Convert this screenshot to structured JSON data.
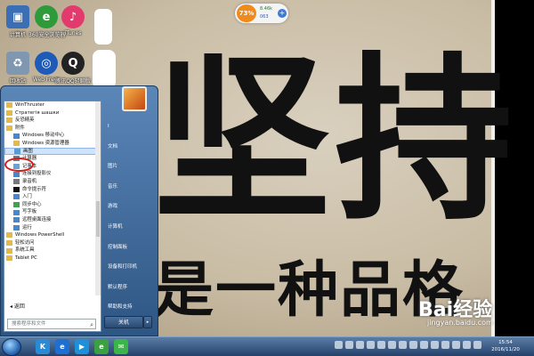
{
  "desktop": {
    "big_text_1": "坚持",
    "big_text_2": "是一种品格",
    "icons": [
      {
        "label": "计算机",
        "color": "#3b6fb5",
        "icon": "computer-icon"
      },
      {
        "label": "360安全浏览器",
        "color": "#2f9a3a",
        "icon": "browser-icon"
      },
      {
        "label": "iTunes",
        "color": "#e23a6c",
        "icon": "music-icon"
      },
      {
        "label": "回收站",
        "color": "#7f97b0",
        "icon": "recycle-bin-icon"
      },
      {
        "label": "Web Freer",
        "color": "#1e5bb8",
        "icon": "globe-icon"
      },
      {
        "label": "腾讯QQ轻聊版",
        "color": "#222222",
        "icon": "qq-icon"
      }
    ]
  },
  "widget": {
    "percent": "73%",
    "value1": "8.46k",
    "value2": "063"
  },
  "start_menu": {
    "programs": [
      {
        "label": "WinThruster",
        "icon": "folder-icon",
        "color": "#e3b94b"
      },
      {
        "label": "Стратегія шашки",
        "icon": "folder-icon",
        "color": "#e3b94b"
      },
      {
        "label": "反恐精英",
        "icon": "folder-icon",
        "color": "#e3b94b"
      },
      {
        "label": "附件",
        "icon": "folder-icon",
        "color": "#e3b94b"
      },
      {
        "label": "Windows 移动中心",
        "icon": "mobility-icon",
        "color": "#4a87c9"
      },
      {
        "label": "Windows 资源管理器",
        "icon": "explorer-icon",
        "color": "#e3b94b"
      },
      {
        "label": "画图",
        "icon": "paint-icon",
        "color": "#5a9ad6",
        "selected": true
      },
      {
        "label": "计算器",
        "icon": "calculator-icon",
        "color": "#6b7b8c"
      },
      {
        "label": "记事本",
        "icon": "notepad-icon",
        "color": "#6aa2d8"
      },
      {
        "label": "连接到投影仪",
        "icon": "projector-icon",
        "color": "#4a87c9"
      },
      {
        "label": "录音机",
        "icon": "recorder-icon",
        "color": "#777777"
      },
      {
        "label": "命令提示符",
        "icon": "cmd-icon",
        "color": "#111111"
      },
      {
        "label": "入门",
        "icon": "start-icon",
        "color": "#4a87c9"
      },
      {
        "label": "同步中心",
        "icon": "sync-icon",
        "color": "#3fa34d"
      },
      {
        "label": "写字板",
        "icon": "wordpad-icon",
        "color": "#4a87c9"
      },
      {
        "label": "远程桌面连接",
        "icon": "remote-desktop-icon",
        "color": "#4a87c9"
      },
      {
        "label": "运行",
        "icon": "run-icon",
        "color": "#4a87c9"
      },
      {
        "label": "Windows PowerShell",
        "icon": "folder-icon",
        "color": "#e3b94b"
      },
      {
        "label": "轻松访问",
        "icon": "folder-icon",
        "color": "#e3b94b"
      },
      {
        "label": "系统工具",
        "icon": "folder-icon",
        "color": "#e3b94b"
      },
      {
        "label": "Tablet PC",
        "icon": "folder-icon",
        "color": "#e3b94b"
      }
    ],
    "back_label": "返回",
    "search_placeholder": "搜索程序和文件",
    "right_items": [
      "I",
      "文档",
      "图片",
      "音乐",
      "游戏",
      "计算机",
      "控制面板",
      "设备和打印机",
      "默认程序",
      "帮助和支持"
    ],
    "shutdown_label": "关机"
  },
  "taskbar": {
    "apps": [
      {
        "name": "k-app-icon",
        "color": "#2b8ad6",
        "glyph": "K"
      },
      {
        "name": "browser-icon",
        "color": "#1f6fd0",
        "glyph": "e"
      },
      {
        "name": "media-player-icon",
        "color": "#1e90d8",
        "glyph": "▶"
      },
      {
        "name": "360-browser-icon",
        "color": "#3aa040",
        "glyph": "e"
      },
      {
        "name": "wechat-icon",
        "color": "#3bb44a",
        "glyph": "✉"
      }
    ],
    "time": "15:54",
    "date": "2016/11/20"
  },
  "watermark": {
    "text": "Bai经验",
    "sub": "jingyan.baidu.com"
  }
}
